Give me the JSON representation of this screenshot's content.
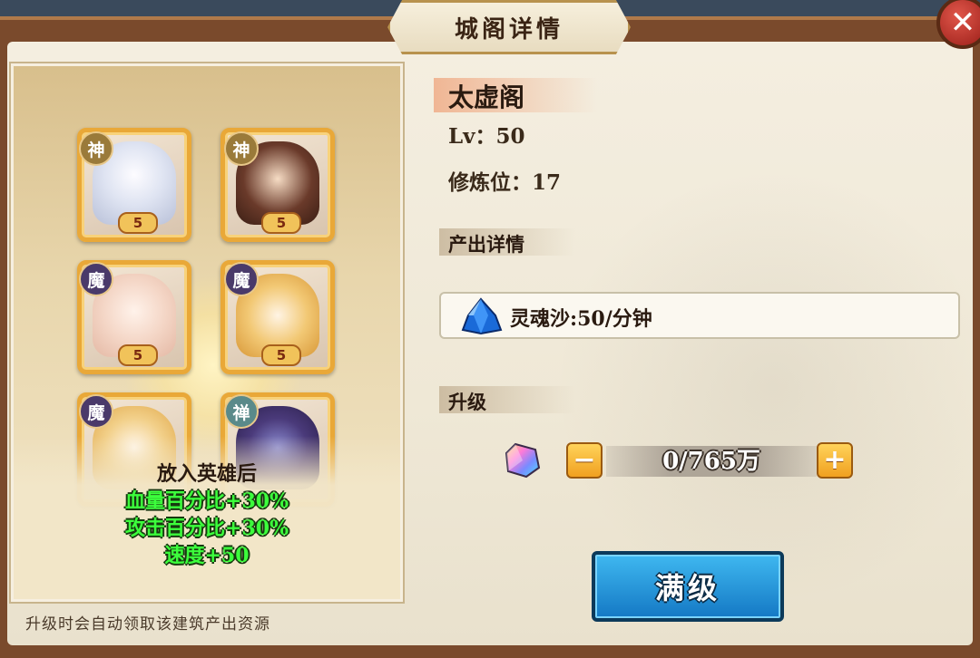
{
  "dialog": {
    "title": "城阁详情",
    "close_label": "✕"
  },
  "heroes": {
    "slots": [
      {
        "badge": "神",
        "stars": "5"
      },
      {
        "badge": "神",
        "stars": "5"
      },
      {
        "badge": "魔",
        "stars": "5"
      },
      {
        "badge": "魔",
        "stars": "5"
      },
      {
        "badge": "魔",
        "stars": ""
      },
      {
        "badge": "禅",
        "stars": ""
      }
    ],
    "bonus_title": "放入英雄后",
    "bonus_lines": [
      "血量百分比+30%",
      "攻击百分比+30%",
      "速度+50"
    ]
  },
  "footnote": "升级时会自动领取该建筑产出资源",
  "building": {
    "name": "太虚阁",
    "level": "Lv：50",
    "cultivation_slots": "修炼位：17"
  },
  "output": {
    "section_label": "产出详情",
    "resource_text": "灵魂沙:50/分钟",
    "resource_icon": "blue-crystal-icon"
  },
  "upgrade": {
    "section_label": "升级",
    "amount": "0/765万",
    "minus_label": "−",
    "plus_label": "+",
    "max_button_label": "满级"
  }
}
